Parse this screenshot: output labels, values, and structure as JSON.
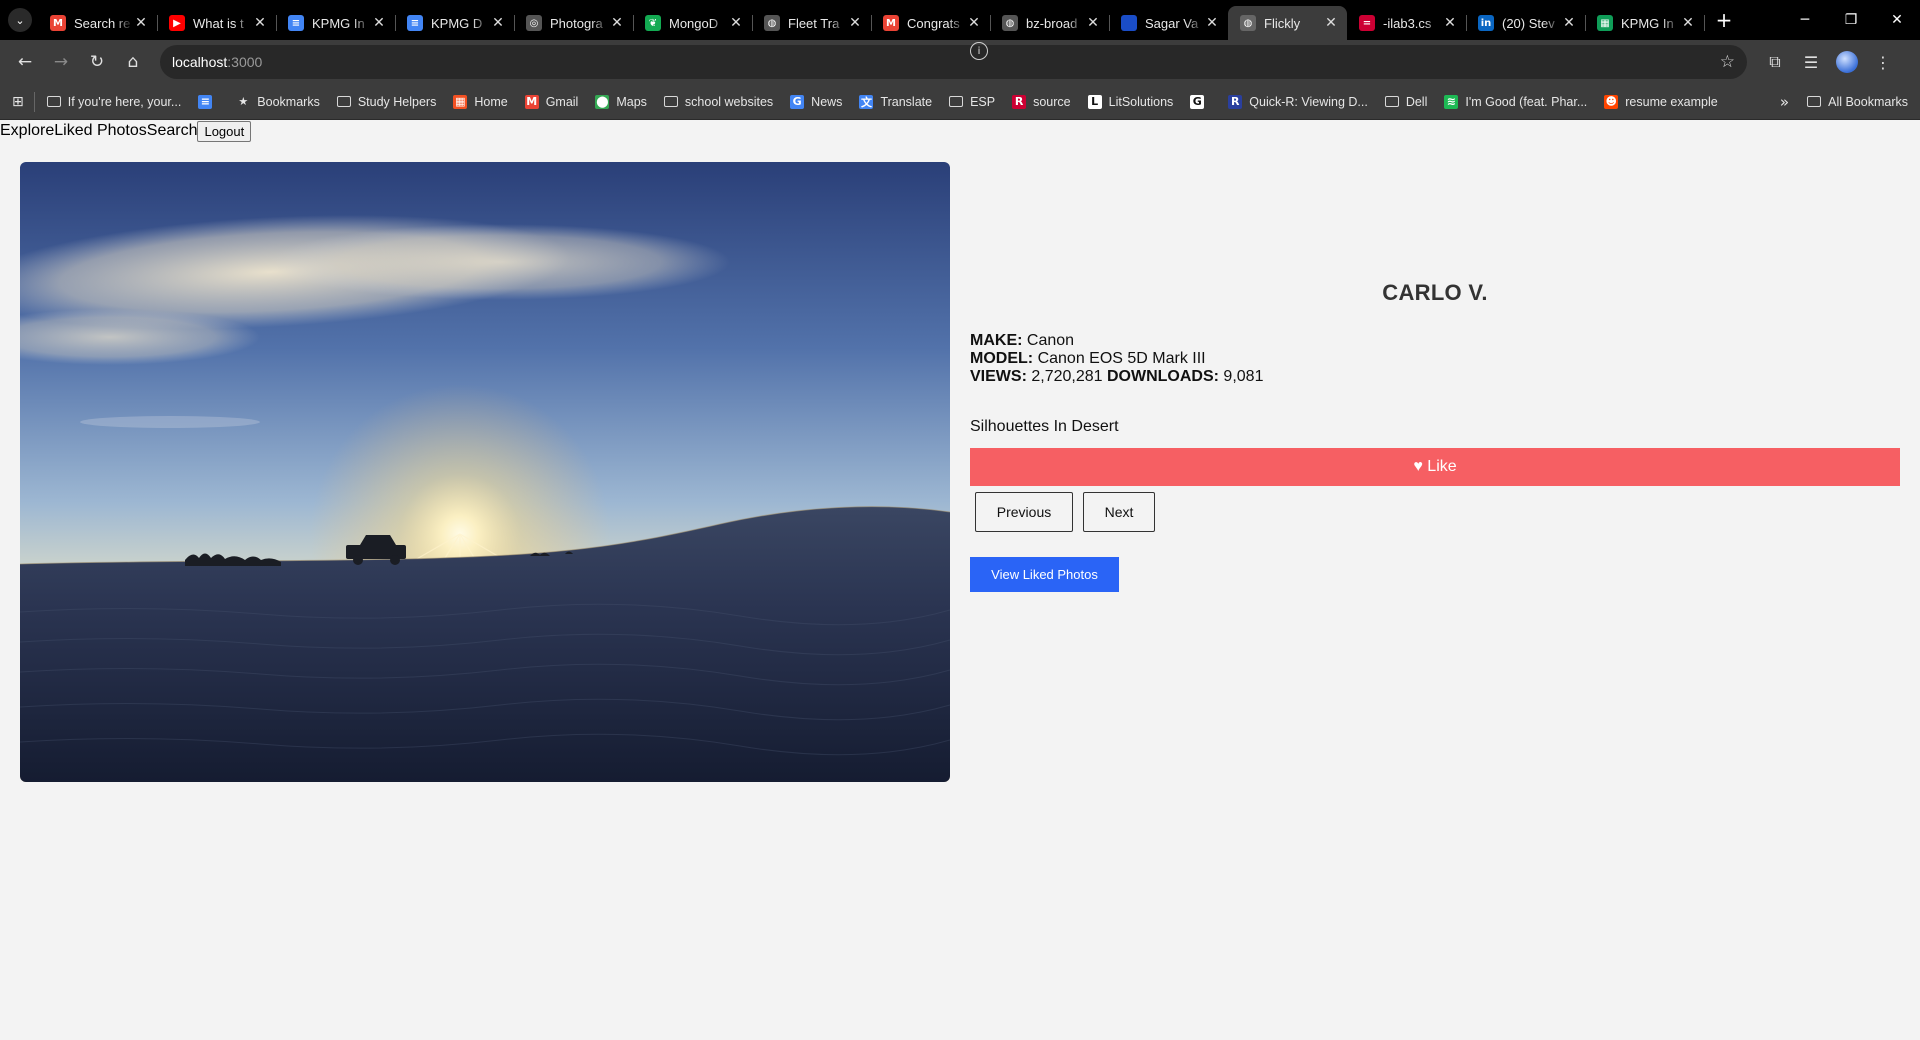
{
  "browser": {
    "tabs": [
      {
        "title": "Search re",
        "favicon": "gmail-icon",
        "color": "#ea4335",
        "glyph": "M"
      },
      {
        "title": "What is t",
        "favicon": "youtube-icon",
        "color": "#ff0000",
        "glyph": "▶"
      },
      {
        "title": "KPMG In",
        "favicon": "docs-icon",
        "color": "#4285f4",
        "glyph": "≡"
      },
      {
        "title": "KPMG D",
        "favicon": "docs-icon",
        "color": "#4285f4",
        "glyph": "≡"
      },
      {
        "title": "Photogra",
        "favicon": "globe-icon",
        "color": "#555555",
        "glyph": "◎"
      },
      {
        "title": "MongoD",
        "favicon": "mongodb-icon",
        "color": "#13aa52",
        "glyph": "❦"
      },
      {
        "title": "Fleet Tra",
        "favicon": "globe-icon",
        "color": "#555555",
        "glyph": "◍"
      },
      {
        "title": "Congrats",
        "favicon": "gmail-icon",
        "color": "#ea4335",
        "glyph": "M"
      },
      {
        "title": "bz-broad",
        "favicon": "globe-icon",
        "color": "#555555",
        "glyph": "◍"
      },
      {
        "title": "Sagar Va",
        "favicon": "doc-blue-icon",
        "color": "#1a4dc7",
        "glyph": " "
      },
      {
        "title": "Flickly",
        "favicon": "globe-icon",
        "color": "#666666",
        "glyph": "◍",
        "active": true
      },
      {
        "title": "-ilab3.cs",
        "favicon": "rutgers-icon",
        "color": "#cc0033",
        "glyph": "="
      },
      {
        "title": "(20) Stev",
        "favicon": "linkedin-icon",
        "color": "#0a66c2",
        "glyph": "in"
      },
      {
        "title": "KPMG In",
        "favicon": "sheets-icon",
        "color": "#0f9d58",
        "glyph": "▦"
      }
    ],
    "new_tab": "+",
    "window_controls": {
      "minimize": "─",
      "restore": "❐",
      "close": "✕"
    },
    "url_host": "localhost",
    "url_port": ":3000",
    "bookmarks": [
      {
        "label": "If you're here, your...",
        "icon": "folder-icon"
      },
      {
        "label": "",
        "icon": "docs-icon",
        "color": "#4285f4",
        "glyph": "≡"
      },
      {
        "label": "Bookmarks",
        "icon": "star-icon",
        "glyph": "★"
      },
      {
        "label": "Study Helpers",
        "icon": "folder-icon"
      },
      {
        "label": "Home",
        "icon": "microsoft-icon",
        "color": "#f25022",
        "glyph": "▦"
      },
      {
        "label": "Gmail",
        "icon": "gmail-icon",
        "color": "#ea4335",
        "glyph": "M"
      },
      {
        "label": "Maps",
        "icon": "maps-icon",
        "color": "#34a853",
        "glyph": "⬤"
      },
      {
        "label": "school websites",
        "icon": "folder-icon"
      },
      {
        "label": "News",
        "icon": "news-icon",
        "color": "#4285f4",
        "glyph": "G"
      },
      {
        "label": "Translate",
        "icon": "translate-icon",
        "color": "#4285f4",
        "glyph": "文"
      },
      {
        "label": "ESP",
        "icon": "folder-icon"
      },
      {
        "label": "source",
        "icon": "rutgers-icon",
        "color": "#cc0033",
        "glyph": "R"
      },
      {
        "label": "LitSolutions",
        "icon": "litsolutions-icon",
        "color": "#ffffff",
        "glyph": "L"
      },
      {
        "label": "",
        "icon": "google-icon",
        "color": "#ffffff",
        "glyph": "G"
      },
      {
        "label": "Quick-R: Viewing D...",
        "icon": "quickr-icon",
        "color": "#2a3f9e",
        "glyph": "R"
      },
      {
        "label": "Dell",
        "icon": "folder-icon"
      },
      {
        "label": "I'm Good (feat. Phar...",
        "icon": "spotify-icon",
        "color": "#1db954",
        "glyph": "≋"
      },
      {
        "label": "resume example",
        "icon": "reddit-icon",
        "color": "#ff4500",
        "glyph": "☻"
      }
    ],
    "bookmarks_overflow": "»",
    "all_bookmarks": "All Bookmarks"
  },
  "nav": {
    "explore": "Explore",
    "liked": "Liked Photos",
    "search": "Search",
    "logout": "Logout"
  },
  "photo": {
    "author": "CARLO V.",
    "make_label": "MAKE:",
    "make": "Canon",
    "model_label": "MODEL:",
    "model": "Canon EOS 5D Mark III",
    "views_label": "VIEWS:",
    "views": "2,720,281",
    "downloads_label": "DOWNLOADS:",
    "downloads": "9,081",
    "description": "Silhouettes In Desert"
  },
  "actions": {
    "like": "♥ Like",
    "previous": "Previous",
    "next": "Next",
    "view_liked": "View Liked Photos"
  },
  "colors": {
    "like": "#f65f63",
    "view_liked": "#2a64f6",
    "page_bg": "#f3f3f3"
  }
}
